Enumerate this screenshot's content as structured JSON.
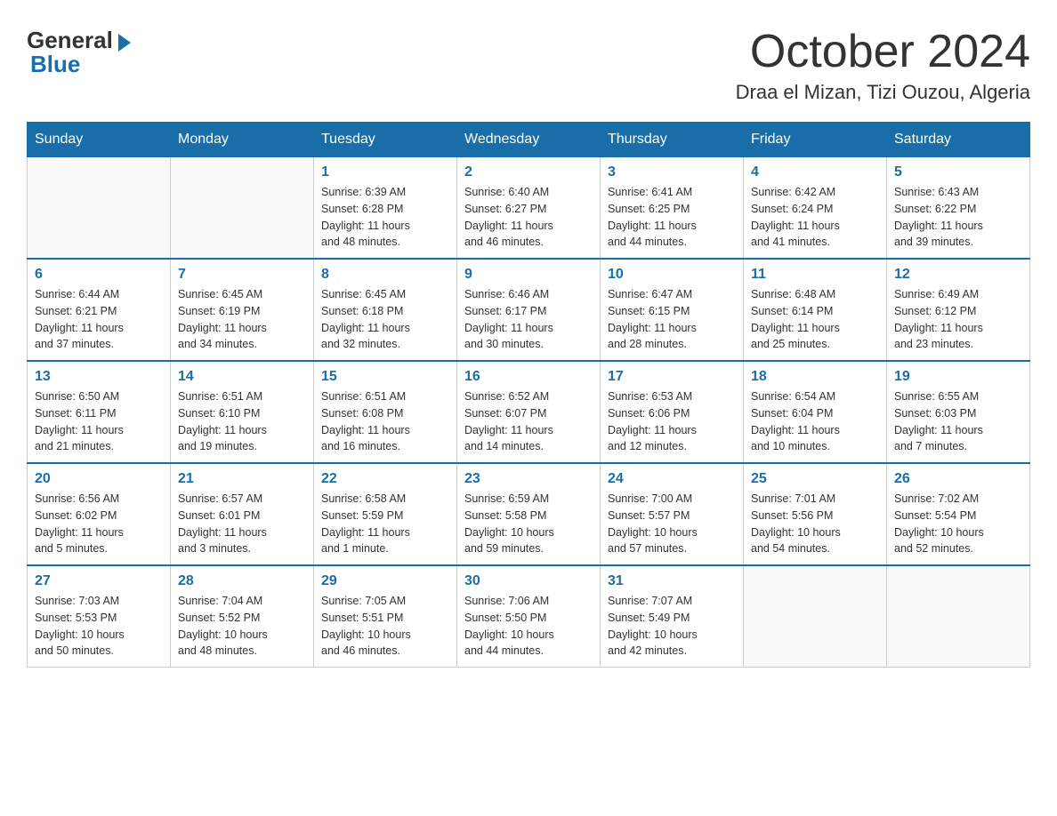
{
  "logo": {
    "general": "General",
    "blue": "Blue"
  },
  "title": "October 2024",
  "location": "Draa el Mizan, Tizi Ouzou, Algeria",
  "days_of_week": [
    "Sunday",
    "Monday",
    "Tuesday",
    "Wednesday",
    "Thursday",
    "Friday",
    "Saturday"
  ],
  "weeks": [
    [
      {
        "day": "",
        "info": ""
      },
      {
        "day": "",
        "info": ""
      },
      {
        "day": "1",
        "info": "Sunrise: 6:39 AM\nSunset: 6:28 PM\nDaylight: 11 hours\nand 48 minutes."
      },
      {
        "day": "2",
        "info": "Sunrise: 6:40 AM\nSunset: 6:27 PM\nDaylight: 11 hours\nand 46 minutes."
      },
      {
        "day": "3",
        "info": "Sunrise: 6:41 AM\nSunset: 6:25 PM\nDaylight: 11 hours\nand 44 minutes."
      },
      {
        "day": "4",
        "info": "Sunrise: 6:42 AM\nSunset: 6:24 PM\nDaylight: 11 hours\nand 41 minutes."
      },
      {
        "day": "5",
        "info": "Sunrise: 6:43 AM\nSunset: 6:22 PM\nDaylight: 11 hours\nand 39 minutes."
      }
    ],
    [
      {
        "day": "6",
        "info": "Sunrise: 6:44 AM\nSunset: 6:21 PM\nDaylight: 11 hours\nand 37 minutes."
      },
      {
        "day": "7",
        "info": "Sunrise: 6:45 AM\nSunset: 6:19 PM\nDaylight: 11 hours\nand 34 minutes."
      },
      {
        "day": "8",
        "info": "Sunrise: 6:45 AM\nSunset: 6:18 PM\nDaylight: 11 hours\nand 32 minutes."
      },
      {
        "day": "9",
        "info": "Sunrise: 6:46 AM\nSunset: 6:17 PM\nDaylight: 11 hours\nand 30 minutes."
      },
      {
        "day": "10",
        "info": "Sunrise: 6:47 AM\nSunset: 6:15 PM\nDaylight: 11 hours\nand 28 minutes."
      },
      {
        "day": "11",
        "info": "Sunrise: 6:48 AM\nSunset: 6:14 PM\nDaylight: 11 hours\nand 25 minutes."
      },
      {
        "day": "12",
        "info": "Sunrise: 6:49 AM\nSunset: 6:12 PM\nDaylight: 11 hours\nand 23 minutes."
      }
    ],
    [
      {
        "day": "13",
        "info": "Sunrise: 6:50 AM\nSunset: 6:11 PM\nDaylight: 11 hours\nand 21 minutes."
      },
      {
        "day": "14",
        "info": "Sunrise: 6:51 AM\nSunset: 6:10 PM\nDaylight: 11 hours\nand 19 minutes."
      },
      {
        "day": "15",
        "info": "Sunrise: 6:51 AM\nSunset: 6:08 PM\nDaylight: 11 hours\nand 16 minutes."
      },
      {
        "day": "16",
        "info": "Sunrise: 6:52 AM\nSunset: 6:07 PM\nDaylight: 11 hours\nand 14 minutes."
      },
      {
        "day": "17",
        "info": "Sunrise: 6:53 AM\nSunset: 6:06 PM\nDaylight: 11 hours\nand 12 minutes."
      },
      {
        "day": "18",
        "info": "Sunrise: 6:54 AM\nSunset: 6:04 PM\nDaylight: 11 hours\nand 10 minutes."
      },
      {
        "day": "19",
        "info": "Sunrise: 6:55 AM\nSunset: 6:03 PM\nDaylight: 11 hours\nand 7 minutes."
      }
    ],
    [
      {
        "day": "20",
        "info": "Sunrise: 6:56 AM\nSunset: 6:02 PM\nDaylight: 11 hours\nand 5 minutes."
      },
      {
        "day": "21",
        "info": "Sunrise: 6:57 AM\nSunset: 6:01 PM\nDaylight: 11 hours\nand 3 minutes."
      },
      {
        "day": "22",
        "info": "Sunrise: 6:58 AM\nSunset: 5:59 PM\nDaylight: 11 hours\nand 1 minute."
      },
      {
        "day": "23",
        "info": "Sunrise: 6:59 AM\nSunset: 5:58 PM\nDaylight: 10 hours\nand 59 minutes."
      },
      {
        "day": "24",
        "info": "Sunrise: 7:00 AM\nSunset: 5:57 PM\nDaylight: 10 hours\nand 57 minutes."
      },
      {
        "day": "25",
        "info": "Sunrise: 7:01 AM\nSunset: 5:56 PM\nDaylight: 10 hours\nand 54 minutes."
      },
      {
        "day": "26",
        "info": "Sunrise: 7:02 AM\nSunset: 5:54 PM\nDaylight: 10 hours\nand 52 minutes."
      }
    ],
    [
      {
        "day": "27",
        "info": "Sunrise: 7:03 AM\nSunset: 5:53 PM\nDaylight: 10 hours\nand 50 minutes."
      },
      {
        "day": "28",
        "info": "Sunrise: 7:04 AM\nSunset: 5:52 PM\nDaylight: 10 hours\nand 48 minutes."
      },
      {
        "day": "29",
        "info": "Sunrise: 7:05 AM\nSunset: 5:51 PM\nDaylight: 10 hours\nand 46 minutes."
      },
      {
        "day": "30",
        "info": "Sunrise: 7:06 AM\nSunset: 5:50 PM\nDaylight: 10 hours\nand 44 minutes."
      },
      {
        "day": "31",
        "info": "Sunrise: 7:07 AM\nSunset: 5:49 PM\nDaylight: 10 hours\nand 42 minutes."
      },
      {
        "day": "",
        "info": ""
      },
      {
        "day": "",
        "info": ""
      }
    ]
  ]
}
